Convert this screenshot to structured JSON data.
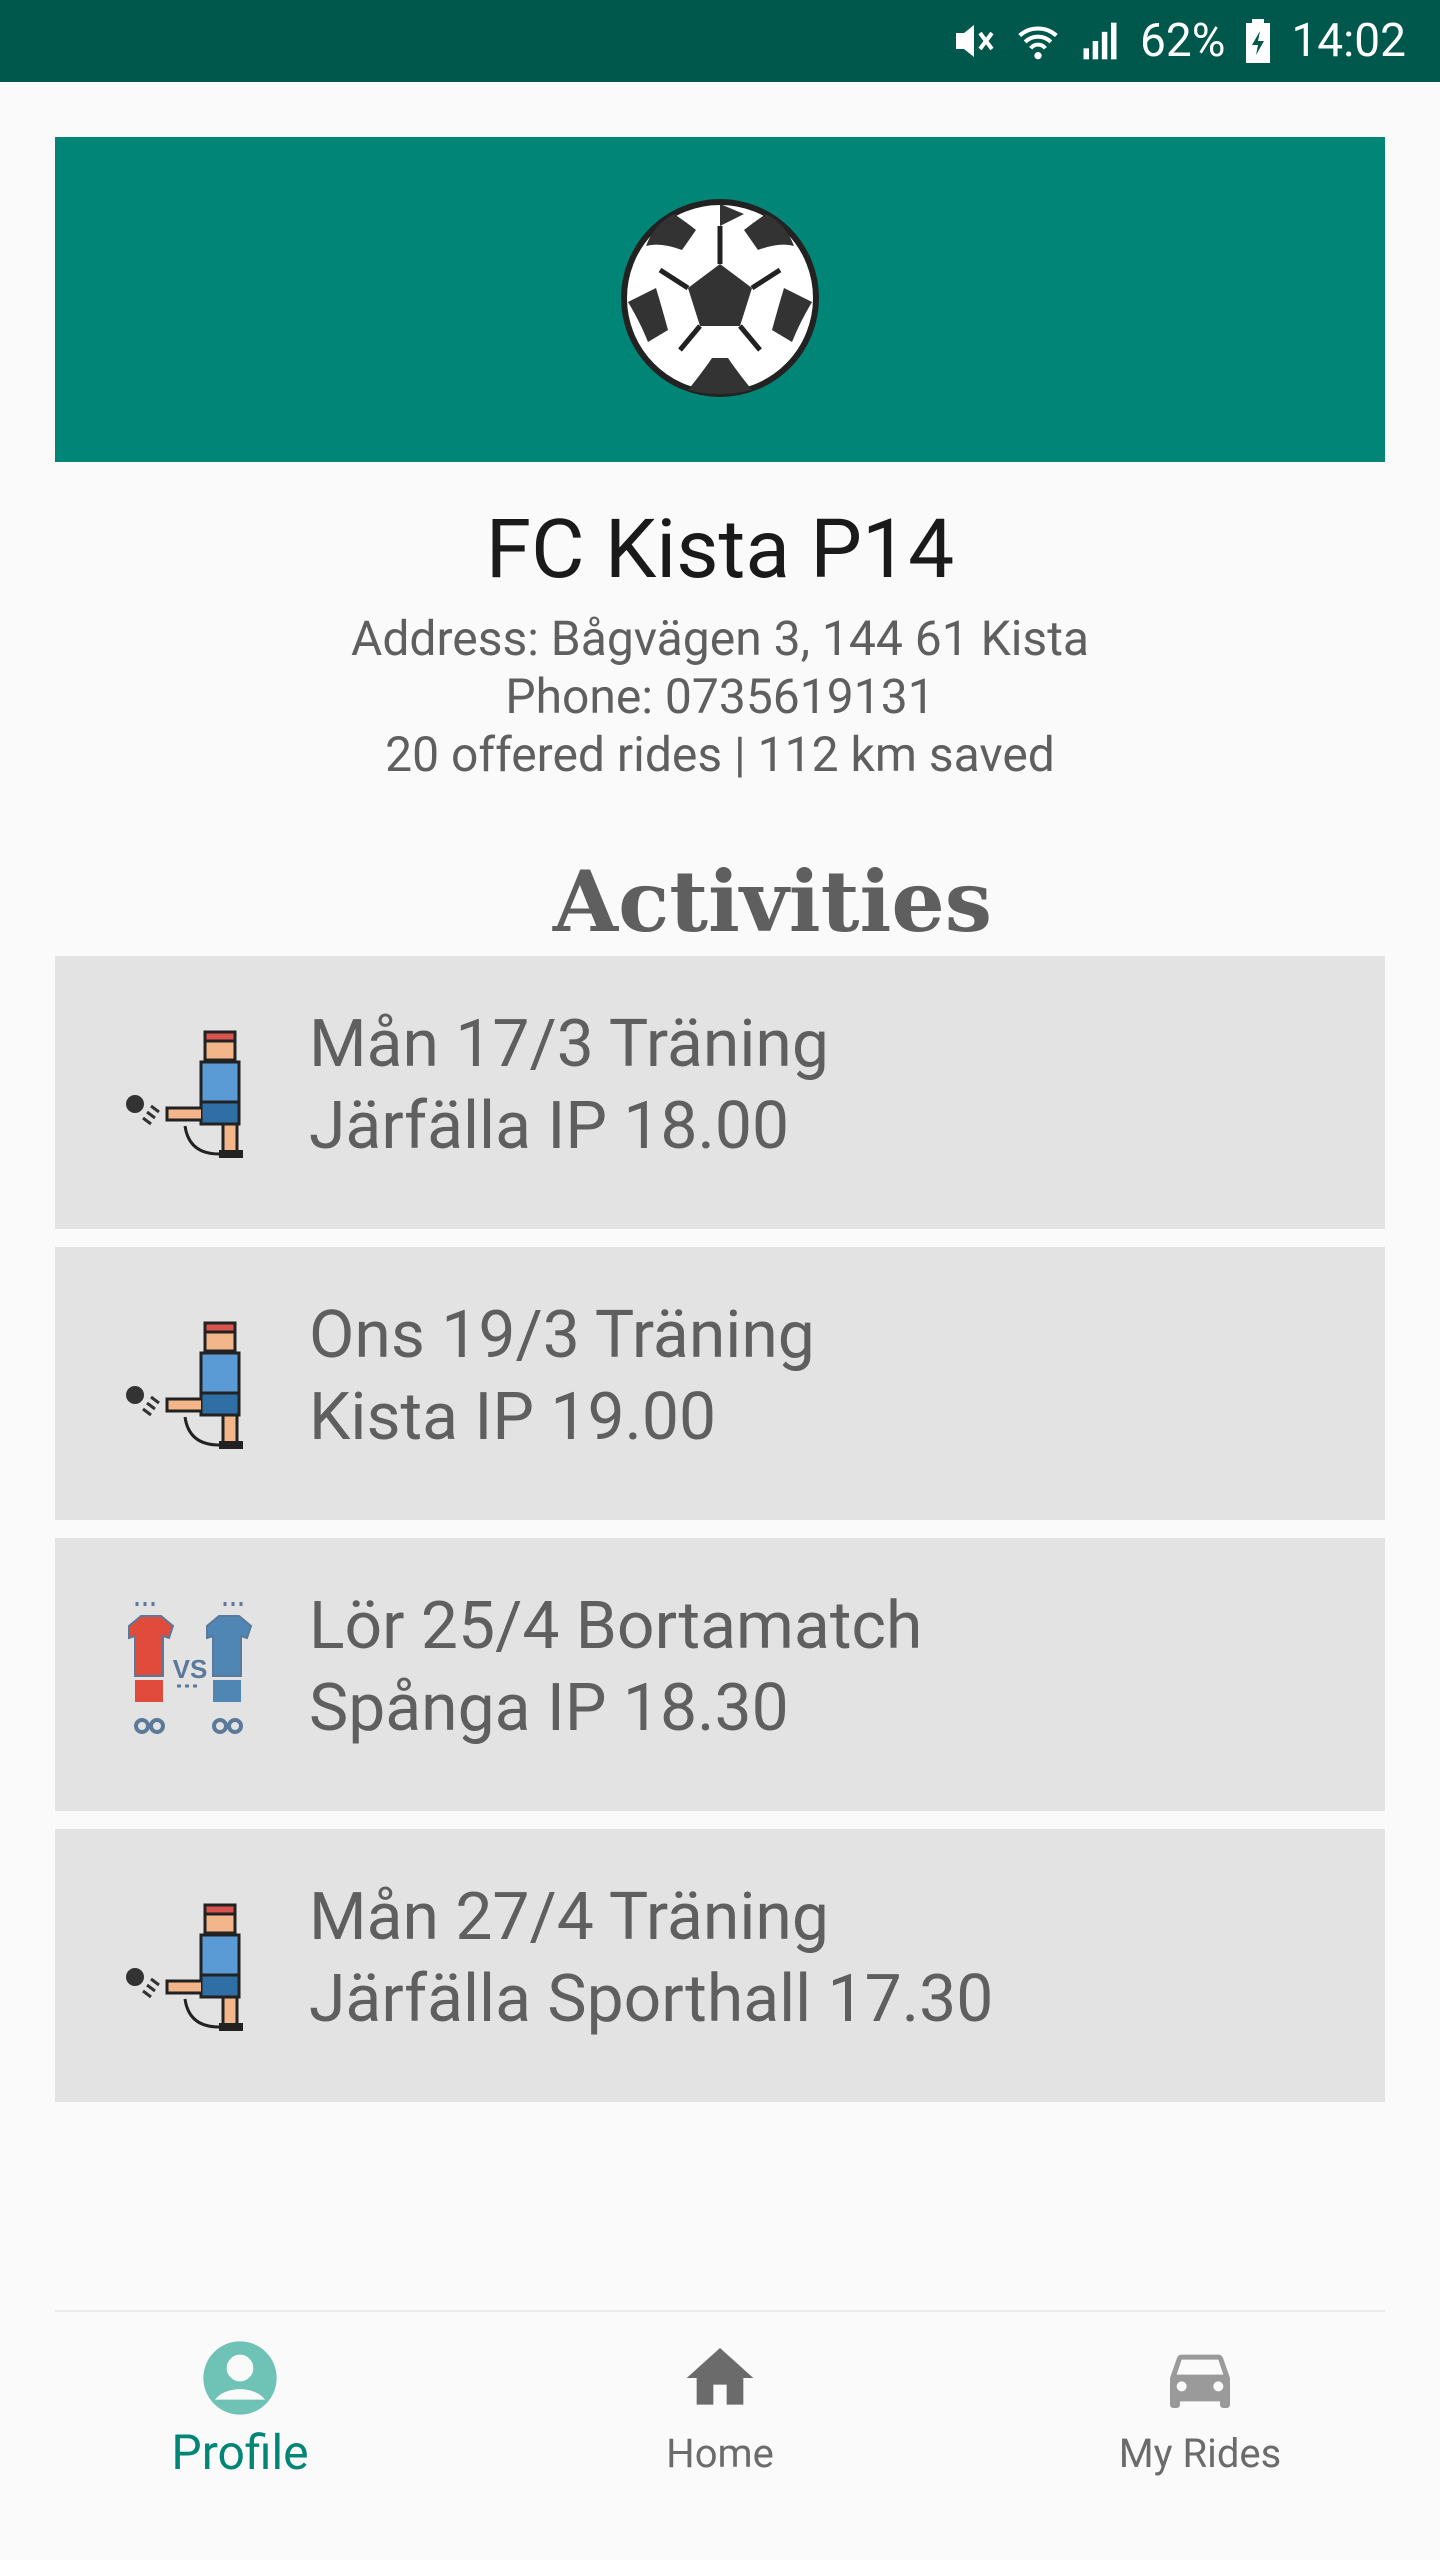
{
  "status_bar": {
    "battery": "62%",
    "time": "14:02",
    "icons": [
      "mute-icon",
      "wifi-icon",
      "signal-icon",
      "battery-icon"
    ]
  },
  "banner": {
    "icon": "soccer-ball-icon",
    "color": "#008577"
  },
  "team": {
    "name": "FC Kista P14",
    "address": "Address: Bågvägen 3, 144 61 Kista",
    "phone": "Phone: 0735619131",
    "stats": "20 offered rides | 112 km saved"
  },
  "activities": {
    "title": "Activities",
    "items": [
      {
        "icon": "player-kicking-icon",
        "line1": "Mån 17/3 Träning",
        "line2": "Järfälla IP 18.00"
      },
      {
        "icon": "player-kicking-icon",
        "line1": "Ons 19/3 Träning",
        "line2": "Kista IP 19.00"
      },
      {
        "icon": "versus-match-icon",
        "line1": "Lör 25/4 Bortamatch",
        "line2": "Spånga IP 18.30"
      },
      {
        "icon": "player-kicking-icon",
        "line1": "Mån 27/4 Träning",
        "line2": "Järfälla Sporthall 17.30"
      }
    ]
  },
  "bottom_nav": {
    "items": [
      {
        "label": "Profile",
        "icon": "profile-icon",
        "active": true
      },
      {
        "label": "Home",
        "icon": "home-icon",
        "active": false
      },
      {
        "label": "My Rides",
        "icon": "car-icon",
        "active": false
      }
    ]
  },
  "colors": {
    "primary": "#008577",
    "primary_dark": "#00574b",
    "card": "#e3e3e3"
  }
}
